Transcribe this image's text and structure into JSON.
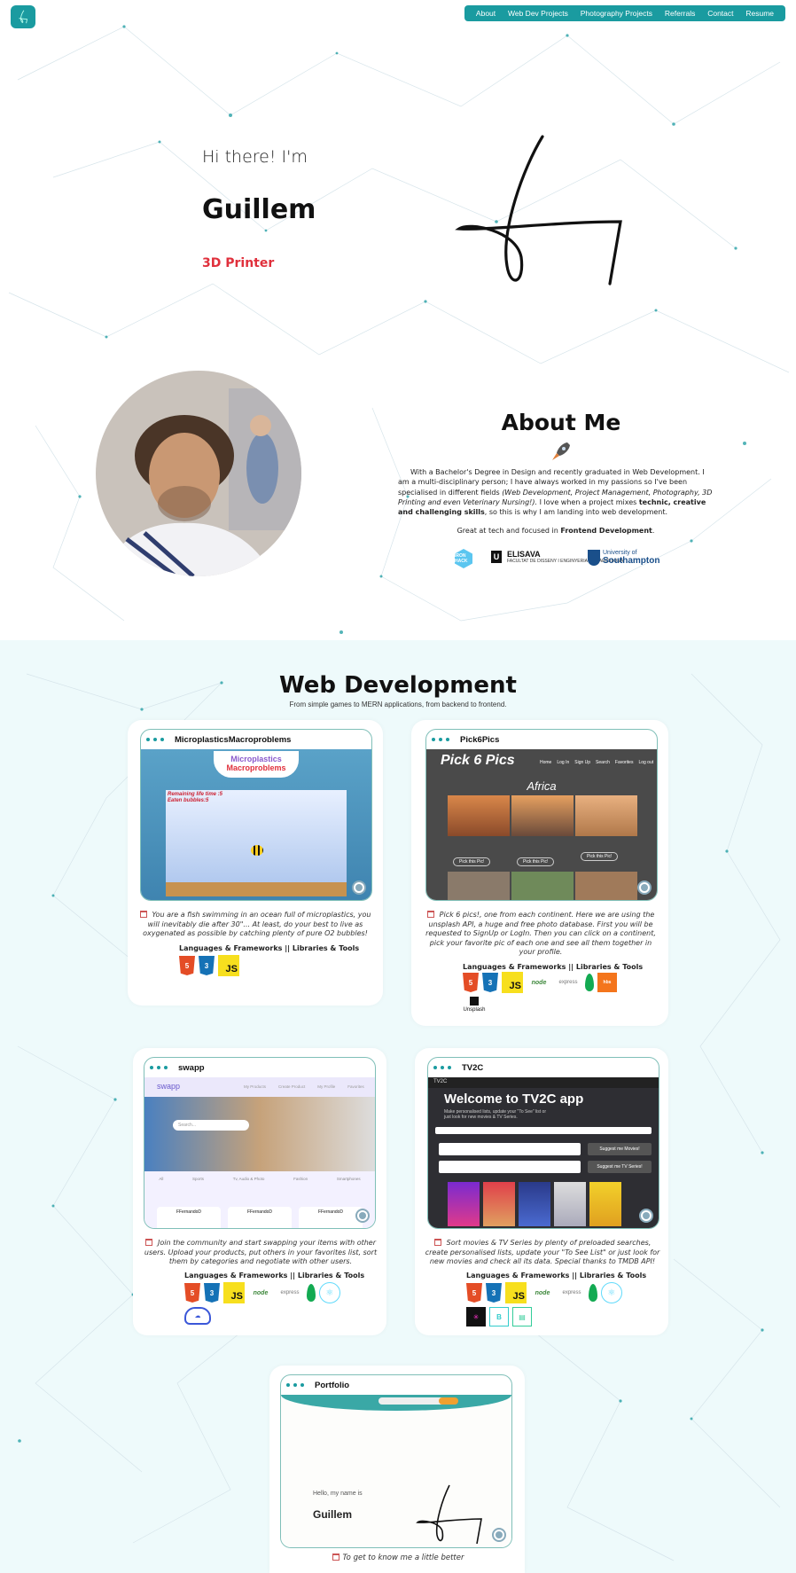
{
  "nav": {
    "logo_letter": "G",
    "items": [
      "About",
      "Web Dev Projects",
      "Photography Projects",
      "Referrals",
      "Contact",
      "Resume"
    ]
  },
  "hero": {
    "greeting": "Hi there! I'm",
    "name": "Guillem",
    "role": "3D Printer"
  },
  "about": {
    "title": "About Me",
    "intro_plain": "With a Bachelor's Degree in Design and recently graduated in Web Development. I am a multi-disciplinary person; I have always worked in my passions so I've been specialised in different fields ",
    "intro_fields": "(Web Development, Project Management, Photography, 3D Printing and even Veterinary Nursing!).",
    "intro_mix": " I love when a project mixes ",
    "intro_strong": "technic, creative and challenging skills",
    "intro_end": ", so this is why I am landing into web development.",
    "focus_prefix": "Great at tech and focused in ",
    "focus_strong": "Frontend Development",
    "focus_suffix": ".",
    "schools": {
      "ironhack": "IRON HACK",
      "elisava": "ELISAVA",
      "elisava_sub": "FACULTAT DE DISSENY I ENGINYERIA DE BARCELONA",
      "soton_small": "University of",
      "soton": "Southampton"
    }
  },
  "webdev": {
    "title": "Web Development",
    "subtitle": "From simple games to MERN applications, from backend to frontend.",
    "lang_label": "Languages & Frameworks || Libraries & Tools",
    "projects": [
      {
        "title": "MicroplasticsMacroproblems",
        "shot_title": "Microplastics",
        "shot_title2": "Macroproblems",
        "shot_info": "Remaining life time :5",
        "shot_info2": "Eaten bubbles:5",
        "description": "You are a fish swimming in an ocean full of microplastics, you will inevitably die after 30\"... At least, do your best to live as oxygenated as possible by catching plenty of pure O2 bubbles!"
      },
      {
        "title": "Pick6Pics",
        "shot_title": "Pick 6 Pics",
        "shot_region": "Africa",
        "shot_menu": [
          "Home",
          "Log In",
          "Sign Up",
          "Search",
          "Favorites",
          "Log out"
        ],
        "shot_btn": "Pick this Pic!",
        "description": "Pick 6 pics!, one from each continent. Here we are using the unsplash API, a huge and free photo database. First you will be requested to SignUp or LogIn. Then you can click on a continent, pick your favorite pic of each one and see all them together in your profile."
      },
      {
        "title": "swapp",
        "shot_brand": "swapp",
        "shot_menu": [
          "My Products",
          "Create Product",
          "My Profile",
          "Favorites"
        ],
        "shot_search": "Search...",
        "shot_cats": [
          "All",
          "Sports",
          "Tv, Audio & Photo",
          "Fashion",
          "Smartphones"
        ],
        "shot_user": "FFernandoD",
        "description": "Join the community and start swapping your items with other users. Upload your products, put others in your favorites list, sort them by categories and negotiate with other users."
      },
      {
        "title": "TV2C",
        "shot_brand": "TV2C",
        "shot_heading": "Welcome to TV2C app",
        "shot_sub": "Make personalised lists, update your \"To See\" list or just look for new movies & TV Series.",
        "shot_btn1": "Suggest me Movies!",
        "shot_btn2": "Suggest me TV Series!",
        "description": "Sort movies & TV Series by plenty of preloaded searches, create personalised lists, update your \"To See List\" or just look for new movies and check all its data. Special thanks to TMDB API!"
      },
      {
        "title": "Portfolio",
        "shot_hi": "Hello, my name is",
        "shot_name": "Guillem",
        "caption": "To get to know me a little better"
      }
    ]
  },
  "colors": {
    "accent": "#1a9ba0",
    "role": "#e0303c",
    "section_bg": "#eefafb"
  }
}
